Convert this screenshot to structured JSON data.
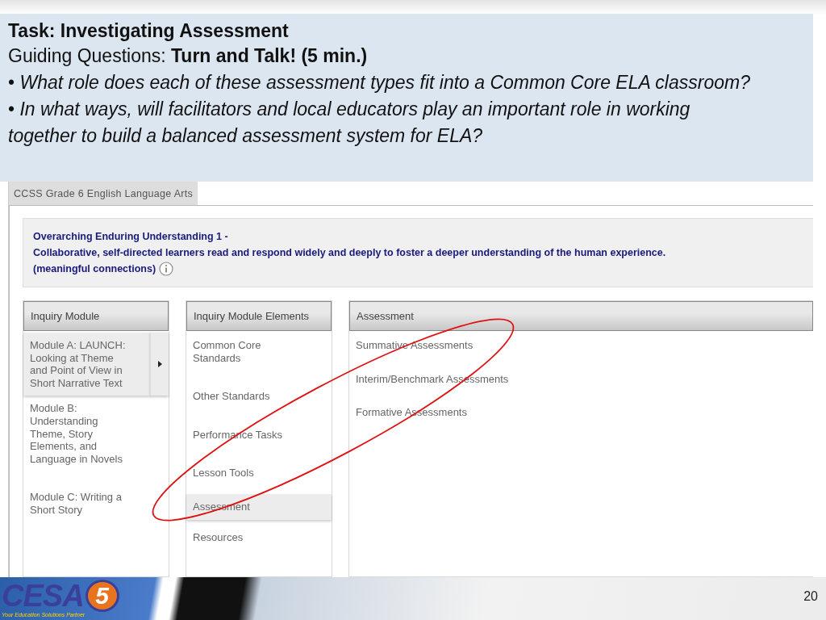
{
  "task": {
    "title": "Task:  Investigating Assessment",
    "guiding": "Guiding Questions: **Turn and Talk! (5 min.)**",
    "bullets": [
      "•  *What role does each of these assessment types fit into a Common Core ELA classroom?*",
      "•  *In what ways, will facilitators and local educators play an important role in working together to build a balanced assessment system for ELA?*"
    ]
  },
  "app": {
    "tab": "CCSS Grade 6 English Language Arts",
    "understanding": {
      "title": "Overarching Enduring Understanding 1 -",
      "text": "Collaborative, self-directed learners read and respond widely and deeply to foster a deeper understanding of the human experience.",
      "tag": "(meaningful connections)"
    },
    "columns": [
      {
        "header": "Inquiry Module",
        "items": [
          {
            "label": "Module A: LAUNCH:  Looking at Theme and Point of View in Short Narrative Text",
            "selected": true
          },
          {
            "label": "Module B: Understanding Theme, Story Elements, and Language in Novels",
            "selected": false
          },
          {
            "label": "Module C: Writing a Short Story",
            "selected": false
          }
        ]
      },
      {
        "header": "Inquiry Module Elements",
        "items": [
          {
            "label": "Common Core Standards",
            "selected": false
          },
          {
            "label": "Other Standards",
            "selected": false
          },
          {
            "label": "Performance Tasks",
            "selected": false
          },
          {
            "label": "Lesson Tools",
            "selected": false
          },
          {
            "label": "Assessment",
            "selected": true
          },
          {
            "label": "Resources",
            "selected": false
          }
        ]
      },
      {
        "header": "Assessment",
        "items": [
          {
            "label": "Summative Assessments",
            "selected": false
          },
          {
            "label": "Interim/Benchmark Assessments",
            "selected": false
          },
          {
            "label": "Formative Assessments",
            "selected": false
          }
        ]
      }
    ]
  },
  "footer": {
    "logo": "CESA",
    "logo_number": "5",
    "tagline": "Your Education Solutions Partner",
    "page": "20"
  }
}
